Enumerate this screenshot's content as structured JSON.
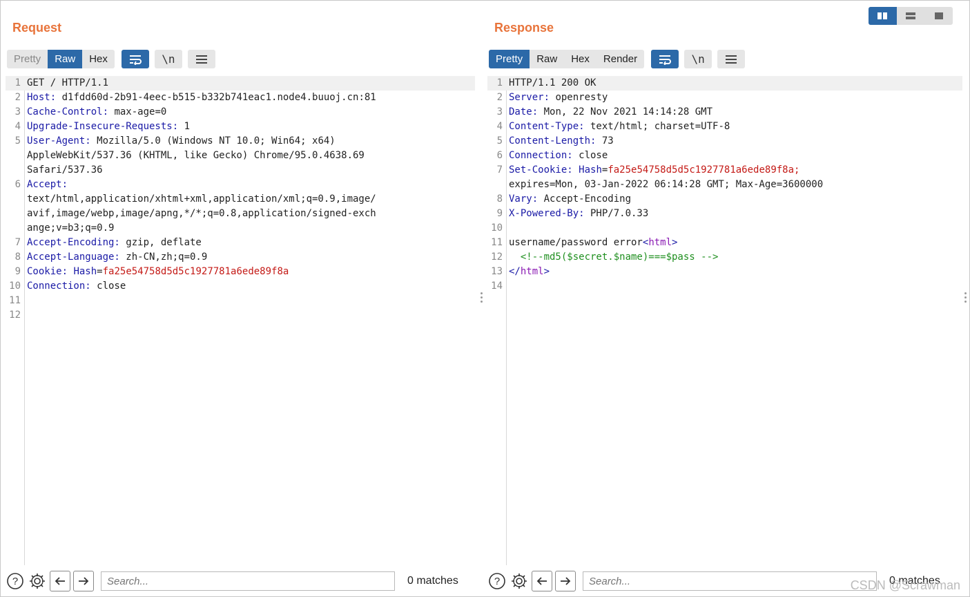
{
  "request": {
    "title": "Request",
    "tabs": [
      {
        "label": "Pretty",
        "state": "disabled"
      },
      {
        "label": "Raw",
        "state": "active"
      },
      {
        "label": "Hex",
        "state": "normal"
      }
    ],
    "newline_label": "\\n",
    "lines": [
      {
        "n": "1",
        "parts": [
          {
            "t": "GET / HTTP/1.1",
            "c": "v"
          }
        ]
      },
      {
        "n": "2",
        "parts": [
          {
            "t": "Host:",
            "c": "k"
          },
          {
            "t": " d1fdd60d-2b91-4eec-b515-b332b741eac1.node4.buuoj.cn:81",
            "c": "v"
          }
        ]
      },
      {
        "n": "3",
        "parts": [
          {
            "t": "Cache-Control:",
            "c": "k"
          },
          {
            "t": " max-age=0",
            "c": "v"
          }
        ]
      },
      {
        "n": "4",
        "parts": [
          {
            "t": "Upgrade-Insecure-Requests:",
            "c": "k"
          },
          {
            "t": " 1",
            "c": "v"
          }
        ]
      },
      {
        "n": "5",
        "parts": [
          {
            "t": "User-Agent:",
            "c": "k"
          },
          {
            "t": " Mozilla/5.0 (Windows NT 10.0; Win64; x64)",
            "c": "v"
          }
        ]
      },
      {
        "n": "",
        "parts": [
          {
            "t": "AppleWebKit/537.36 (KHTML, like Gecko) Chrome/95.0.4638.69",
            "c": "v"
          }
        ]
      },
      {
        "n": "",
        "parts": [
          {
            "t": "Safari/537.36",
            "c": "v"
          }
        ]
      },
      {
        "n": "6",
        "parts": [
          {
            "t": "Accept:",
            "c": "k"
          }
        ]
      },
      {
        "n": "",
        "parts": [
          {
            "t": "text/html,application/xhtml+xml,application/xml;q=0.9,image/",
            "c": "v"
          }
        ]
      },
      {
        "n": "",
        "parts": [
          {
            "t": "avif,image/webp,image/apng,*/*;q=0.8,application/signed-exch",
            "c": "v"
          }
        ]
      },
      {
        "n": "",
        "parts": [
          {
            "t": "ange;v=b3;q=0.9",
            "c": "v"
          }
        ]
      },
      {
        "n": "7",
        "parts": [
          {
            "t": "Accept-Encoding:",
            "c": "k"
          },
          {
            "t": " gzip, deflate",
            "c": "v"
          }
        ]
      },
      {
        "n": "8",
        "parts": [
          {
            "t": "Accept-Language:",
            "c": "k"
          },
          {
            "t": " zh-CN,zh;q=0.9",
            "c": "v"
          }
        ]
      },
      {
        "n": "9",
        "parts": [
          {
            "t": "Cookie:",
            "c": "k"
          },
          {
            "t": " ",
            "c": "v"
          },
          {
            "t": "Hash",
            "c": "k"
          },
          {
            "t": "=",
            "c": "v"
          },
          {
            "t": "fa25e54758d5d5c1927781a6ede89f8a",
            "c": "r"
          }
        ]
      },
      {
        "n": "10",
        "parts": [
          {
            "t": "Connection:",
            "c": "k"
          },
          {
            "t": " close",
            "c": "v"
          }
        ]
      },
      {
        "n": "11",
        "parts": []
      },
      {
        "n": "12",
        "parts": []
      }
    ],
    "search_placeholder": "Search...",
    "matches": "0 matches"
  },
  "response": {
    "title": "Response",
    "tabs": [
      {
        "label": "Pretty",
        "state": "active"
      },
      {
        "label": "Raw",
        "state": "normal"
      },
      {
        "label": "Hex",
        "state": "normal"
      },
      {
        "label": "Render",
        "state": "normal"
      }
    ],
    "newline_label": "\\n",
    "lines": [
      {
        "n": "1",
        "parts": [
          {
            "t": "HTTP/1.1 200 OK",
            "c": "v"
          }
        ]
      },
      {
        "n": "2",
        "parts": [
          {
            "t": "Server:",
            "c": "k"
          },
          {
            "t": " openresty",
            "c": "v"
          }
        ]
      },
      {
        "n": "3",
        "parts": [
          {
            "t": "Date:",
            "c": "k"
          },
          {
            "t": " Mon, 22 Nov 2021 14:14:28 GMT",
            "c": "v"
          }
        ]
      },
      {
        "n": "4",
        "parts": [
          {
            "t": "Content-Type:",
            "c": "k"
          },
          {
            "t": " text/html; charset=UTF-8",
            "c": "v"
          }
        ]
      },
      {
        "n": "5",
        "parts": [
          {
            "t": "Content-Length:",
            "c": "k"
          },
          {
            "t": " 73",
            "c": "v"
          }
        ]
      },
      {
        "n": "6",
        "parts": [
          {
            "t": "Connection:",
            "c": "k"
          },
          {
            "t": " close",
            "c": "v"
          }
        ]
      },
      {
        "n": "7",
        "parts": [
          {
            "t": "Set-Cookie:",
            "c": "k"
          },
          {
            "t": " ",
            "c": "v"
          },
          {
            "t": "Hash",
            "c": "k"
          },
          {
            "t": "=",
            "c": "v"
          },
          {
            "t": "fa25e54758d5d5c1927781a6ede89f8a;",
            "c": "r"
          }
        ]
      },
      {
        "n": "",
        "parts": [
          {
            "t": "expires=Mon, 03-Jan-2022 06:14:28 GMT; Max-Age=3600000",
            "c": "v"
          }
        ]
      },
      {
        "n": "8",
        "parts": [
          {
            "t": "Vary:",
            "c": "k"
          },
          {
            "t": " Accept-Encoding",
            "c": "v"
          }
        ]
      },
      {
        "n": "9",
        "parts": [
          {
            "t": "X-Powered-By:",
            "c": "k"
          },
          {
            "t": " PHP/7.0.33",
            "c": "v"
          }
        ]
      },
      {
        "n": "10",
        "parts": []
      },
      {
        "n": "11",
        "parts": [
          {
            "t": "username/password error",
            "c": "v"
          },
          {
            "t": "<",
            "c": "tagb"
          },
          {
            "t": "html",
            "c": "tag"
          },
          {
            "t": ">",
            "c": "tagb"
          }
        ]
      },
      {
        "n": "12",
        "parts": [
          {
            "t": "  <!--md5($secret.$name)===$pass -->",
            "c": "cm"
          }
        ]
      },
      {
        "n": "13",
        "parts": [
          {
            "t": "</",
            "c": "tagb"
          },
          {
            "t": "html",
            "c": "tag"
          },
          {
            "t": ">",
            "c": "tagb"
          }
        ]
      },
      {
        "n": "14",
        "parts": []
      }
    ],
    "search_placeholder": "Search...",
    "matches": "0 matches"
  },
  "watermark": "CSDN @Scrawman",
  "colors": {
    "accent": "#2c69a8",
    "title": "#e8743b",
    "key": "#1a1aa6",
    "value_red": "#c41a16",
    "comment": "#1f8f1f"
  }
}
